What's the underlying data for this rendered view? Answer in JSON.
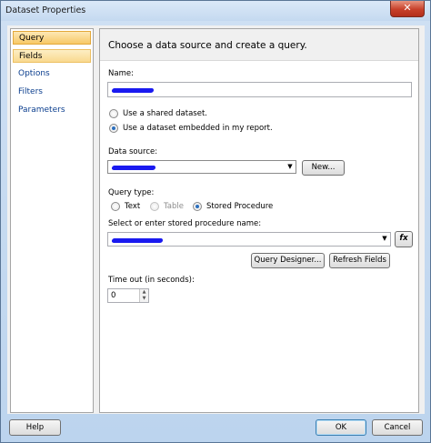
{
  "window": {
    "title": "Dataset Properties",
    "close_label": "✕"
  },
  "sidebar": {
    "items": [
      {
        "label": "Query"
      },
      {
        "label": "Fields"
      },
      {
        "label": "Options"
      },
      {
        "label": "Filters"
      },
      {
        "label": "Parameters"
      }
    ]
  },
  "main": {
    "header": "Choose a data source and create a query.",
    "name_label": "Name:",
    "dataset_mode": {
      "options": [
        "Use a shared dataset.",
        "Use a dataset embedded in my report."
      ],
      "selected": "Use a dataset embedded in my report."
    },
    "data_source_label": "Data source:",
    "new_button": "New...",
    "query_type_label": "Query type:",
    "query_types": [
      "Text",
      "Table",
      "Stored Procedure"
    ],
    "query_type_selected": "Stored Procedure",
    "stored_proc_label": "Select or enter stored procedure name:",
    "fx_button": "fx",
    "query_designer_button": "Query Designer...",
    "refresh_fields_button": "Refresh Fields",
    "timeout_label": "Time out (in seconds):",
    "timeout_value": "0"
  },
  "footer": {
    "help_button": "Help",
    "ok_button": "OK",
    "cancel_button": "Cancel"
  }
}
